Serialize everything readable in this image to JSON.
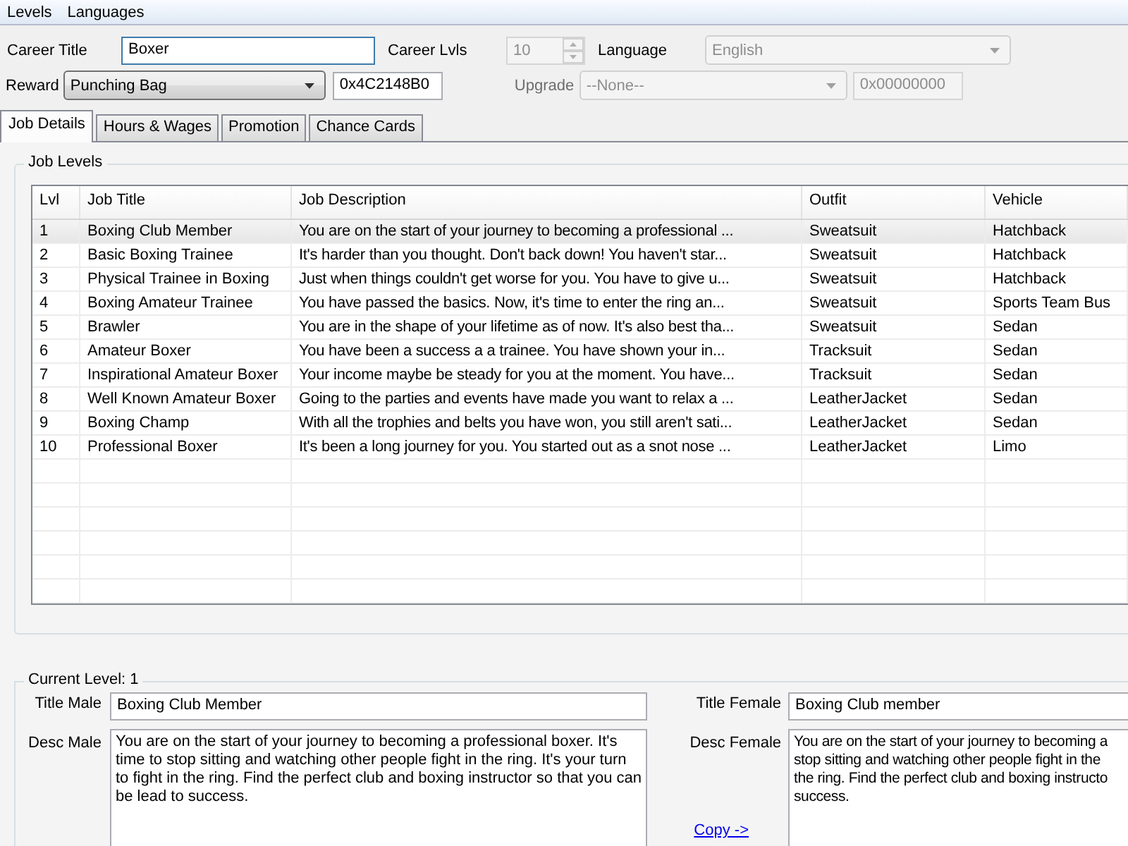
{
  "menu": [
    {
      "label": "Levels"
    },
    {
      "label": "Languages"
    }
  ],
  "career": {
    "title_label": "Career Title",
    "title_value": "Boxer",
    "levels_label": "Career Lvls",
    "levels_value": "10",
    "levels_disabled": true,
    "language_label": "Language",
    "language_value": "English",
    "language_disabled": true
  },
  "reward": {
    "label": "Reward",
    "value": "Punching Bag",
    "code": "0x4C2148B0"
  },
  "upgrade": {
    "label": "Upgrade",
    "value": "--None--",
    "code": "0x00000000",
    "disabled": true
  },
  "tabs": [
    {
      "label": "Job Details",
      "selected": true
    },
    {
      "label": "Hours & Wages",
      "selected": false
    },
    {
      "label": "Promotion",
      "selected": false
    },
    {
      "label": "Chance Cards",
      "selected": false
    }
  ],
  "job_levels": {
    "title": "Job Levels",
    "columns": [
      "Lvl",
      "Job Title",
      "Job Description",
      "Outfit",
      "Vehicle"
    ],
    "rows": [
      {
        "selected": true,
        "cells": [
          "1",
          "Boxing Club Member",
          "You are on the start of your journey to becoming a professional ...",
          "Sweatsuit",
          "Hatchback"
        ]
      },
      {
        "selected": false,
        "cells": [
          "2",
          "Basic Boxing Trainee",
          "It's harder than you thought. Don't back down! You haven't star...",
          "Sweatsuit",
          "Hatchback"
        ]
      },
      {
        "selected": false,
        "cells": [
          "3",
          "Physical Trainee in Boxing",
          "Just when things couldn't get worse for you. You have to give u...",
          "Sweatsuit",
          "Hatchback"
        ]
      },
      {
        "selected": false,
        "cells": [
          "4",
          "Boxing Amateur Trainee",
          "You have passed the basics. Now, it's time to enter the ring an...",
          "Sweatsuit",
          "Sports Team Bus"
        ]
      },
      {
        "selected": false,
        "cells": [
          "5",
          "Brawler",
          "You are in the shape of your lifetime as of now. It's also best tha...",
          "Sweatsuit",
          "Sedan"
        ]
      },
      {
        "selected": false,
        "cells": [
          "6",
          "Amateur Boxer",
          "You have been a success a a trainee. You have shown your in...",
          "Tracksuit",
          "Sedan"
        ]
      },
      {
        "selected": false,
        "cells": [
          "7",
          "Inspirational Amateur Boxer",
          "Your income maybe be steady for you at the moment. You have...",
          "Tracksuit",
          "Sedan"
        ]
      },
      {
        "selected": false,
        "cells": [
          "8",
          "Well Known Amateur Boxer",
          "Going to the parties and events have made you want to relax a ...",
          "LeatherJacket",
          "Sedan"
        ]
      },
      {
        "selected": false,
        "cells": [
          "9",
          "Boxing Champ",
          "With all the trophies and belts you have won, you still aren't sati...",
          "LeatherJacket",
          "Sedan"
        ]
      },
      {
        "selected": false,
        "cells": [
          "10",
          "Professional Boxer",
          "It's been a long journey for you. You started out as a snot nose ...",
          "LeatherJacket",
          "Limo"
        ]
      }
    ]
  },
  "current_level": {
    "title": "Current Level: 1",
    "title_male_label": "Title Male",
    "title_male": "Boxing Club Member",
    "desc_male_label": "Desc Male",
    "desc_male": "You are on the start of your journey to becoming a professional boxer. It's time to stop sitting and watching other people fight in the ring. It's your turn to fight in the ring. Find the perfect club and boxing instructor so that you can be lead to success.",
    "title_female_label": "Title Female",
    "title_female": "Boxing Club member",
    "desc_female_label": "Desc Female",
    "desc_female_lines": [
      "You are on the start of your journey to becoming a",
      "stop sitting and watching other people fight in the",
      "the ring. Find the perfect club and boxing instructo",
      "success."
    ],
    "copy_link": "Copy ->"
  }
}
